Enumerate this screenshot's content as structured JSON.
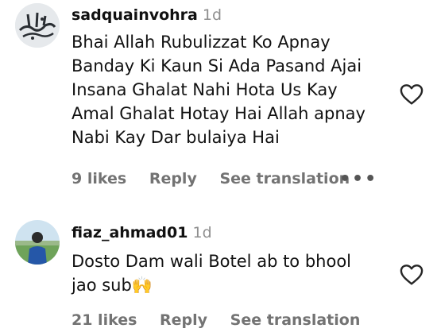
{
  "comments": [
    {
      "username": "sadquainvohra",
      "time": "1d",
      "text": "Bhai Allah Rubulizzat Ko Apnay\nBanday Ki Kaun Si Ada Pasand Ajai\nInsana Ghalat Nahi Hota Us Kay\nAmal Ghalat Hotay Hai Allah apnay\nNabi Kay Dar bulaiya Hai",
      "likes": "9 likes",
      "reply": "Reply",
      "translation": "See translation",
      "more": "•••",
      "avatar_icon": "calligraphy-avatar"
    },
    {
      "username": "fiaz_ahmad01",
      "time": "1d",
      "text": "Dosto Dam wali Botel ab to bhool\njao sub🙌",
      "likes": "21 likes",
      "reply": "Reply",
      "translation": "See translation",
      "avatar_icon": "person-field-avatar"
    }
  ],
  "icons": {
    "like": "heart-outline-icon"
  },
  "colors": {
    "text": "#111111",
    "muted": "#737373",
    "timestamp": "#8e8e8e"
  }
}
